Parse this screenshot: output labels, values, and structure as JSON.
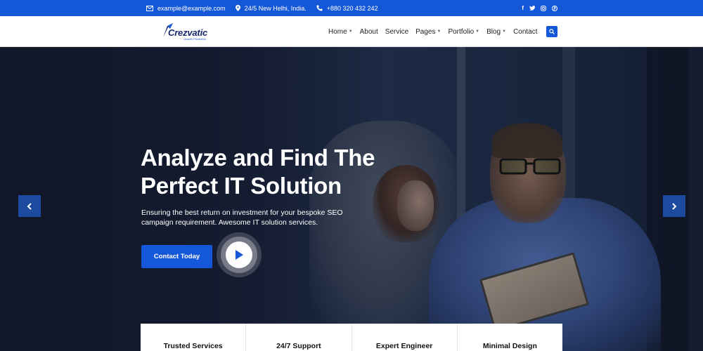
{
  "topbar": {
    "email": "example@example.com",
    "address": "24/5 New Helhi, India.",
    "phone": "+880 320 432 242",
    "social": [
      "f",
      "t",
      "ig",
      "p"
    ]
  },
  "logo": {
    "name": "Crezvatic",
    "tagline": "Growth Prediction"
  },
  "nav": {
    "items": [
      {
        "label": "Home",
        "dropdown": true
      },
      {
        "label": "About",
        "dropdown": false
      },
      {
        "label": "Service",
        "dropdown": false
      },
      {
        "label": "Pages",
        "dropdown": true
      },
      {
        "label": "Portfolio",
        "dropdown": true
      },
      {
        "label": "Blog",
        "dropdown": true
      },
      {
        "label": "Contact",
        "dropdown": false
      }
    ]
  },
  "hero": {
    "title_line1": "Analyze and Find The",
    "title_line2": "Perfect IT Solution",
    "subtitle": "Ensuring the best return on investment for your bespoke SEO campaign requirement. Awesome IT solution services.",
    "cta_label": "Contact Today"
  },
  "features": [
    {
      "label": "Trusted Services"
    },
    {
      "label": "24/7 Support"
    },
    {
      "label": "Expert Engineer"
    },
    {
      "label": "Minimal Design"
    }
  ],
  "colors": {
    "brand": "#1557d9",
    "logo_dark": "#17296e",
    "hero_bg": "#172038"
  }
}
